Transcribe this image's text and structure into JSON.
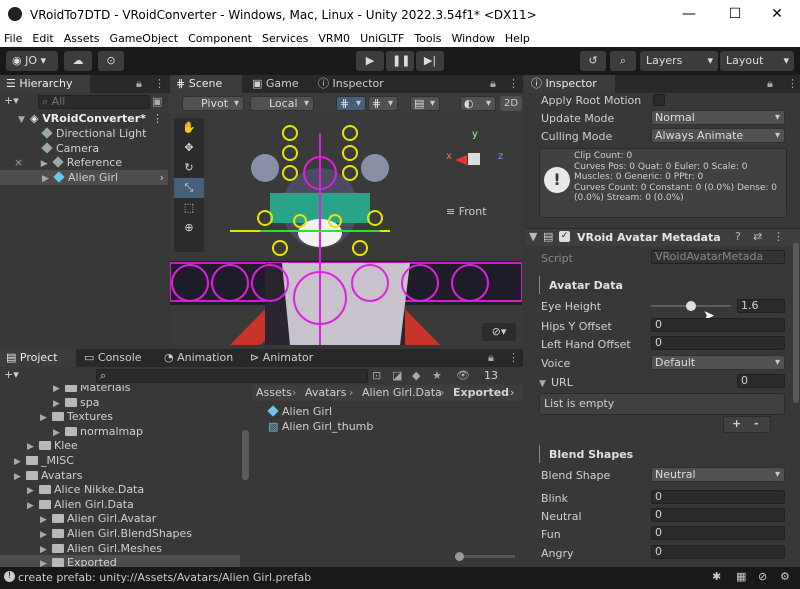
{
  "window": {
    "title": "VRoidTo7DTD - VRoidConverter - Windows, Mac, Linux - Unity 2022.3.54f1* <DX11>",
    "minimize": "—",
    "maximize": "☐",
    "close": "✕"
  },
  "menu": [
    "File",
    "Edit",
    "Assets",
    "GameObject",
    "Component",
    "Services",
    "VRM0",
    "UniGLTF",
    "Tools",
    "Window",
    "Help"
  ],
  "toolbar": {
    "account": "JO",
    "layers": "Layers",
    "layout": "Layout"
  },
  "hierarchy": {
    "tab": "Hierarchy",
    "search_placeholder": "All",
    "root": "VRoidConverter*",
    "items": [
      "Directional Light",
      "Camera",
      "Reference",
      "Alien Girl"
    ]
  },
  "scene": {
    "tabs": [
      "Scene",
      "Game",
      "Inspector"
    ],
    "pivot": "Pivot",
    "local": "Local",
    "mode2d": "2D",
    "gizmo_label": "Front",
    "gizmo_axes": {
      "x": "x",
      "y": "y",
      "z": "z"
    }
  },
  "project": {
    "tabs": [
      "Project",
      "Console",
      "Animation",
      "Animator"
    ],
    "count": "13",
    "breadcrumb": [
      "Assets",
      "Avatars",
      "Alien Girl.Data",
      "Exported"
    ],
    "tree": [
      {
        "label": "Materials",
        "depth": 3
      },
      {
        "label": "spa",
        "depth": 3
      },
      {
        "label": "Textures",
        "depth": 2
      },
      {
        "label": "normalmap",
        "depth": 3
      },
      {
        "label": "Klee",
        "depth": 1
      },
      {
        "label": "_MISC",
        "depth": 0
      },
      {
        "label": "Avatars",
        "depth": 0
      },
      {
        "label": "Alice Nikke.Data",
        "depth": 1
      },
      {
        "label": "Alien Girl.Data",
        "depth": 1
      },
      {
        "label": "Alien Girl.Avatar",
        "depth": 2
      },
      {
        "label": "Alien Girl.BlendShapes",
        "depth": 2
      },
      {
        "label": "Alien Girl.Meshes",
        "depth": 2
      },
      {
        "label": "Exported",
        "depth": 2
      }
    ],
    "files": [
      "Alien Girl",
      "Alien Girl_thumb"
    ]
  },
  "inspector": {
    "tab": "Inspector",
    "apply_root_motion": "Apply Root Motion",
    "update_mode_label": "Update Mode",
    "update_mode": "Normal",
    "culling_mode_label": "Culling Mode",
    "culling_mode": "Always Animate",
    "info": [
      "Clip Count: 0",
      "Curves Pos: 0 Quat: 0 Euler: 0 Scale: 0",
      "Muscles: 0 Generic: 0 PPtr: 0",
      "Curves Count: 0 Constant: 0 (0.0%) Dense: 0",
      "(0.0%) Stream: 0 (0.0%)"
    ],
    "component": "VRoid Avatar Metadata",
    "script_label": "Script",
    "script_value": "VRoidAvatarMetada",
    "avatar_data": "Avatar Data",
    "eye_height_label": "Eye Height",
    "eye_height": "1.6",
    "eye_height_fraction": 0.5,
    "hips_label": "Hips Y Offset",
    "hips": "0",
    "left_hand_label": "Left Hand Offset",
    "left_hand": "0",
    "voice_label": "Voice",
    "voice": "Default",
    "url_label": "URL",
    "url_count": "0",
    "list_empty": "List is empty",
    "plus": "+",
    "minus": "-",
    "blend_shapes": "Blend Shapes",
    "blend_shape_label": "Blend Shape",
    "blend_shape": "Neutral",
    "blends": [
      {
        "label": "Blink",
        "value": "0"
      },
      {
        "label": "Neutral",
        "value": "0"
      },
      {
        "label": "Fun",
        "value": "0"
      },
      {
        "label": "Angry",
        "value": "0"
      }
    ]
  },
  "status": "create prefab: unity://Assets/Avatars/Alien Girl.prefab"
}
